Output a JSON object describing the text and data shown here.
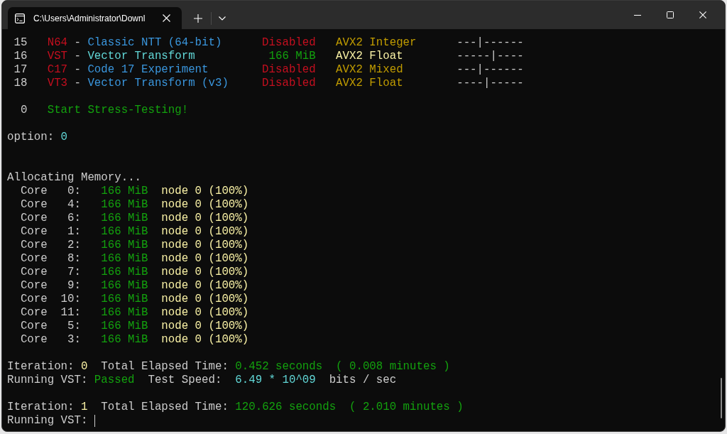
{
  "window": {
    "title": "C:\\Users\\Administrator\\Downl"
  },
  "menu": [
    {
      "number": "15",
      "code": "N64",
      "separator": "-",
      "name": "Classic NTT (64-bit)",
      "status": "Disabled",
      "enabled": false,
      "instruction_set": "AVX2 Integer",
      "indicator": "---|------",
      "selected": false
    },
    {
      "number": "16",
      "code": "VST",
      "separator": "-",
      "name": "Vector Transform",
      "status": "166 MiB",
      "enabled": true,
      "instruction_set": "AVX2 Float",
      "indicator": "-----|----",
      "selected": true
    },
    {
      "number": "17",
      "code": "C17",
      "separator": "-",
      "name": "Code 17 Experiment",
      "status": "Disabled",
      "enabled": false,
      "instruction_set": "AVX2 Mixed",
      "indicator": "---|------",
      "selected": false
    },
    {
      "number": "18",
      "code": "VT3",
      "separator": "-",
      "name": "Vector Transform (v3)",
      "status": "Disabled",
      "enabled": false,
      "instruction_set": "AVX2 Float",
      "indicator": "----|-----",
      "selected": false
    }
  ],
  "start": {
    "number": "0",
    "label": "Start Stress-Testing!"
  },
  "prompt": {
    "label": "option:",
    "value": "0"
  },
  "allocation": {
    "heading": "Allocating Memory...",
    "cores": [
      {
        "label": "Core",
        "index": "0:",
        "memory": "166 MiB",
        "node": "node 0 (100%)"
      },
      {
        "label": "Core",
        "index": "4:",
        "memory": "166 MiB",
        "node": "node 0 (100%)"
      },
      {
        "label": "Core",
        "index": "6:",
        "memory": "166 MiB",
        "node": "node 0 (100%)"
      },
      {
        "label": "Core",
        "index": "1:",
        "memory": "166 MiB",
        "node": "node 0 (100%)"
      },
      {
        "label": "Core",
        "index": "2:",
        "memory": "166 MiB",
        "node": "node 0 (100%)"
      },
      {
        "label": "Core",
        "index": "8:",
        "memory": "166 MiB",
        "node": "node 0 (100%)"
      },
      {
        "label": "Core",
        "index": "7:",
        "memory": "166 MiB",
        "node": "node 0 (100%)"
      },
      {
        "label": "Core",
        "index": "9:",
        "memory": "166 MiB",
        "node": "node 0 (100%)"
      },
      {
        "label": "Core",
        "index": "10:",
        "memory": "166 MiB",
        "node": "node 0 (100%)"
      },
      {
        "label": "Core",
        "index": "11:",
        "memory": "166 MiB",
        "node": "node 0 (100%)"
      },
      {
        "label": "Core",
        "index": "5:",
        "memory": "166 MiB",
        "node": "node 0 (100%)"
      },
      {
        "label": "Core",
        "index": "3:",
        "memory": "166 MiB",
        "node": "node 0 (100%)"
      }
    ]
  },
  "iterations": [
    {
      "label": "Iteration:",
      "number": "0",
      "elapsed_label": "Total Elapsed Time:",
      "seconds": "0.452 seconds",
      "minutes": "( 0.008 minutes )",
      "running_label": "Running VST:",
      "result": "Passed",
      "speed_label": "Test Speed:",
      "speed": "6.49 * 10^09",
      "speed_unit": "bits / sec",
      "cursor": false
    },
    {
      "label": "Iteration:",
      "number": "1",
      "elapsed_label": "Total Elapsed Time:",
      "seconds": "120.626 seconds",
      "minutes": "( 2.010 minutes )",
      "running_label": "Running VST:",
      "cursor": true
    }
  ]
}
